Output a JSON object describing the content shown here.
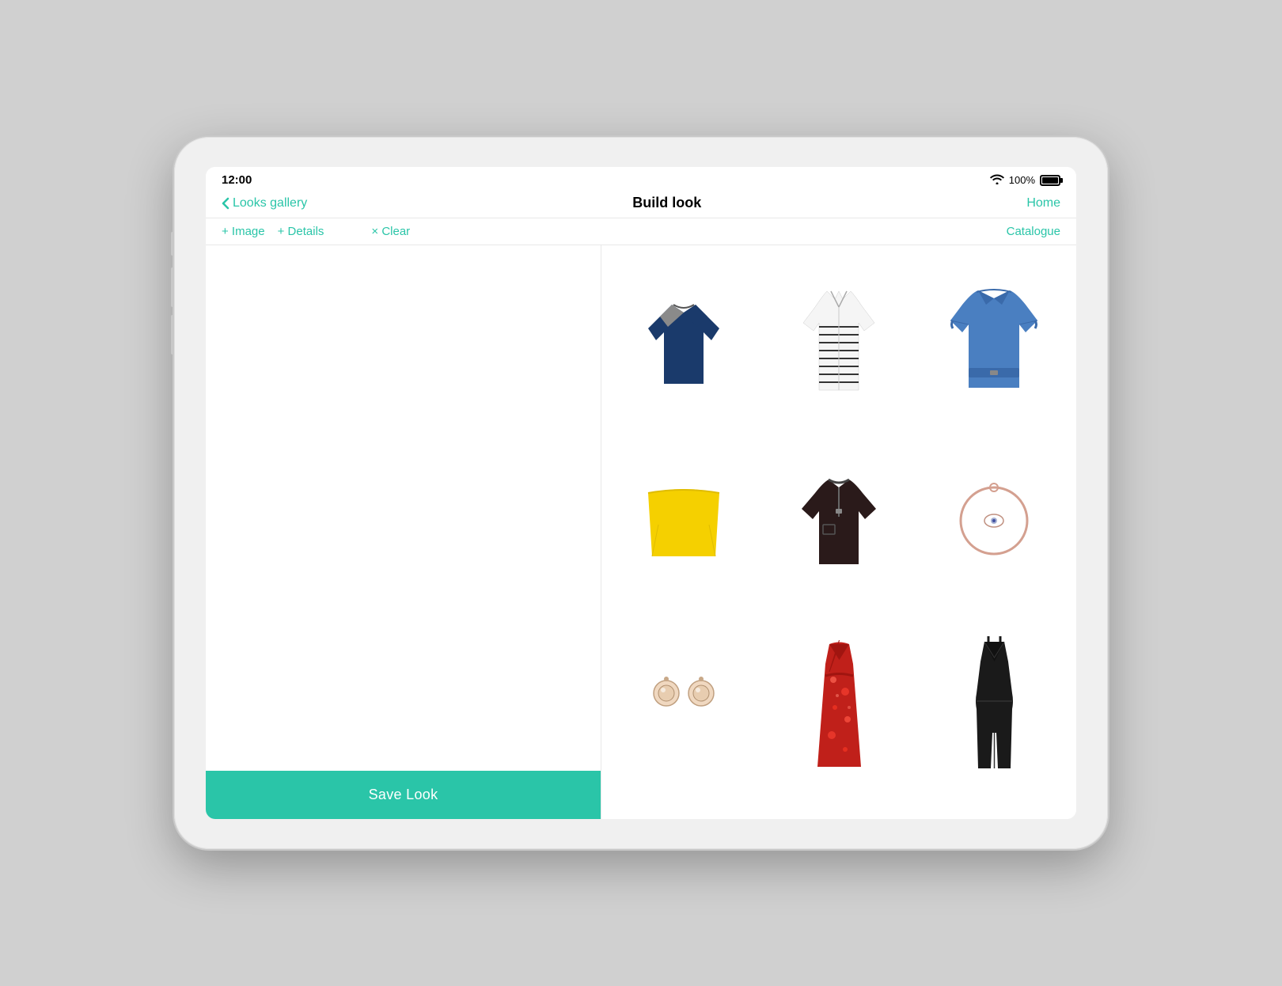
{
  "status": {
    "time": "12:00",
    "battery_percent": "100%"
  },
  "nav": {
    "back_label": "Looks gallery",
    "title": "Build look",
    "home_label": "Home"
  },
  "toolbar": {
    "add_image_label": "+ Image",
    "add_details_label": "+ Details",
    "clear_label": "× Clear",
    "catalogue_label": "Catalogue"
  },
  "save_button": {
    "label": "Save Look"
  },
  "catalogue": {
    "items": [
      {
        "id": "item-1",
        "type": "sweater-navy",
        "alt": "Navy grey sweater"
      },
      {
        "id": "item-2",
        "type": "shirt-striped",
        "alt": "Striped shirt"
      },
      {
        "id": "item-3",
        "type": "denim-jacket",
        "alt": "Denim jacket"
      },
      {
        "id": "item-4",
        "type": "yellow-top",
        "alt": "Yellow off-shoulder top"
      },
      {
        "id": "item-5",
        "type": "black-sweater",
        "alt": "Black zip sweater"
      },
      {
        "id": "item-6",
        "type": "bracelet",
        "alt": "Rose gold bracelet"
      },
      {
        "id": "item-7",
        "type": "earrings",
        "alt": "Crystal earrings"
      },
      {
        "id": "item-8",
        "type": "red-dress",
        "alt": "Red floral dress"
      },
      {
        "id": "item-9",
        "type": "black-jumpsuit",
        "alt": "Black spaghetti jumpsuit"
      }
    ]
  },
  "colors": {
    "accent": "#2ac5a8",
    "text_primary": "#000000",
    "background": "#ffffff"
  }
}
